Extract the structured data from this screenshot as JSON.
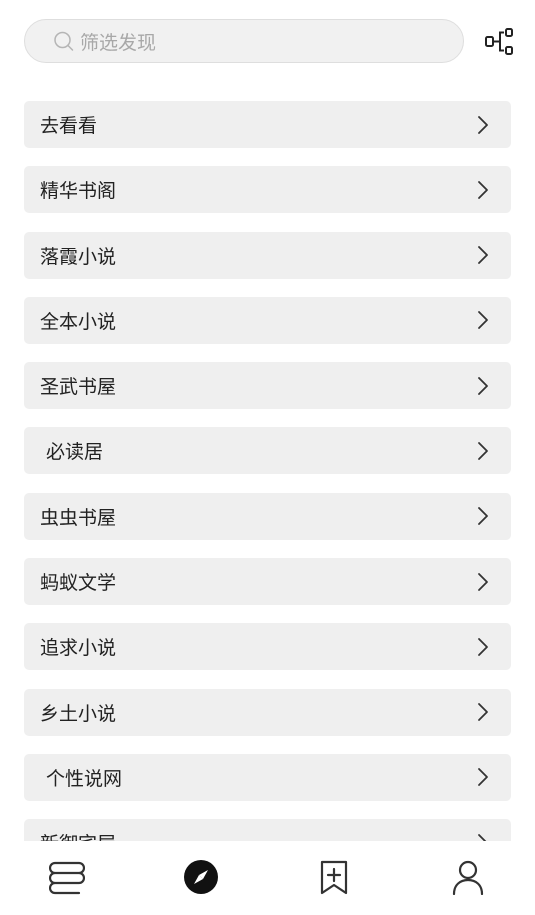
{
  "search": {
    "placeholder": "筛选发现"
  },
  "list": {
    "items": [
      {
        "label": "去看看"
      },
      {
        "label": "精华书阁"
      },
      {
        "label": "落霞小说"
      },
      {
        "label": "全本小说"
      },
      {
        "label": "圣武书屋"
      },
      {
        "label": " 必读居"
      },
      {
        "label": "虫虫书屋"
      },
      {
        "label": "蚂蚁文学"
      },
      {
        "label": "追求小说"
      },
      {
        "label": "乡土小说"
      },
      {
        "label": " 个性说网"
      },
      {
        "label": "新御宅屋"
      }
    ]
  },
  "nav": {
    "tabs": [
      {
        "icon": "bookshelf-icon",
        "active": false
      },
      {
        "icon": "compass-icon",
        "active": true
      },
      {
        "icon": "bookmark-add-icon",
        "active": false
      },
      {
        "icon": "user-icon",
        "active": false
      }
    ]
  },
  "colors": {
    "active": "#111111",
    "inactive": "#333333",
    "item_bg": "#efefef"
  }
}
